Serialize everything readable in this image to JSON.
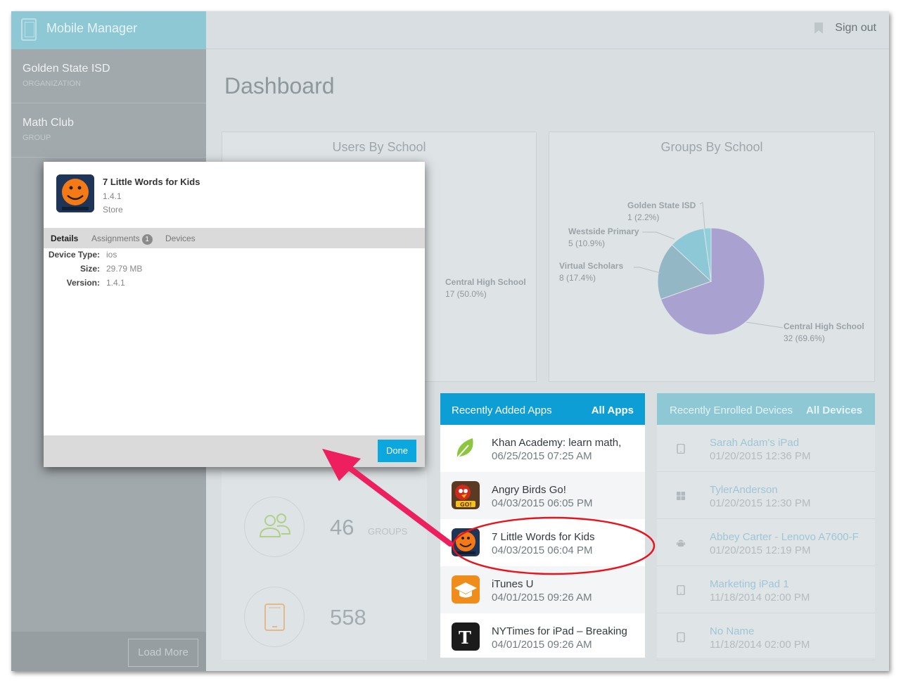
{
  "app": {
    "title": "Mobile Manager"
  },
  "topbar": {
    "signout": "Sign out"
  },
  "sidebar": {
    "items": [
      {
        "name": "Golden State ISD",
        "sub": "ORGANIZATION"
      },
      {
        "name": "Math Club",
        "sub": "GROUP"
      }
    ],
    "load_more": "Load More"
  },
  "page": {
    "title": "Dashboard"
  },
  "users_by_school": {
    "title": "Users By School",
    "visible_label": {
      "name": "Central High School",
      "value": "17 (50.0%)"
    }
  },
  "chart_data": {
    "type": "pie",
    "title": "Groups By School",
    "slices": [
      {
        "label": "Central High School",
        "value": 32,
        "percent": "69.6%",
        "display": "32 (69.6%)",
        "color": "#a9a2d0"
      },
      {
        "label": "Virtual Scholars",
        "value": 8,
        "percent": "17.4%",
        "display": "8 (17.4%)",
        "color": "#94b7c6"
      },
      {
        "label": "Westside Primary",
        "value": 5,
        "percent": "10.9%",
        "display": "5 (10.9%)",
        "color": "#8dc8d6"
      },
      {
        "label": "Golden State ISD",
        "value": 1,
        "percent": "2.2%",
        "display": "1 (2.2%)",
        "color": "#8fd0da"
      }
    ]
  },
  "stats": [
    {
      "value": "46",
      "label": "GROUPS"
    },
    {
      "value": "558",
      "label": ""
    }
  ],
  "recent_apps": {
    "title": "Recently Added Apps",
    "all_link": "All Apps",
    "items": [
      {
        "name": "Khan Academy: learn math,",
        "date": "06/25/2015 07:25 AM",
        "icon": "leaf-icon"
      },
      {
        "name": "Angry Birds Go!",
        "date": "04/03/2015 06:05 PM",
        "icon": "angry-birds-icon"
      },
      {
        "name": "7 Little Words for Kids",
        "date": "04/03/2015 06:04 PM",
        "icon": "orange-face-icon"
      },
      {
        "name": "iTunes U",
        "date": "04/01/2015 09:26 AM",
        "icon": "graduation-cap-icon"
      },
      {
        "name": "NYTimes for iPad – Breaking",
        "date": "04/01/2015 09:26 AM",
        "icon": "nytimes-icon"
      }
    ]
  },
  "recent_devices": {
    "title": "Recently Enrolled Devices",
    "all_link": "All Devices",
    "items": [
      {
        "name": "Sarah Adam's iPad",
        "date": "01/20/2015 12:36 PM",
        "icon": "tablet-icon"
      },
      {
        "name": "TylerAnderson",
        "date": "01/20/2015 12:30 PM",
        "icon": "windows-icon"
      },
      {
        "name": "Abbey Carter - Lenovo A7600-F",
        "date": "01/20/2015 12:19 PM",
        "icon": "android-icon"
      },
      {
        "name": "Marketing iPad 1",
        "date": "11/18/2014 02:00 PM",
        "icon": "tablet-icon"
      },
      {
        "name": "No Name",
        "date": "11/18/2014 02:00 PM",
        "icon": "tablet-icon"
      }
    ]
  },
  "modal": {
    "app_name": "7 Little Words for Kids",
    "version": "1.4.1",
    "source": "Store",
    "tabs": [
      {
        "label": "Details",
        "active": true
      },
      {
        "label": "Assignments",
        "badge": "1"
      },
      {
        "label": "Devices"
      }
    ],
    "details": [
      {
        "label": "Device Type:",
        "value": "ios"
      },
      {
        "label": "Size:",
        "value": "29.79 MB"
      },
      {
        "label": "Version:",
        "value": "1.4.1"
      }
    ],
    "done": "Done"
  },
  "colors": {
    "accent": "#0d9ed5",
    "annotation": "#ee1f5e",
    "highlight_ring": "#e8131d"
  }
}
